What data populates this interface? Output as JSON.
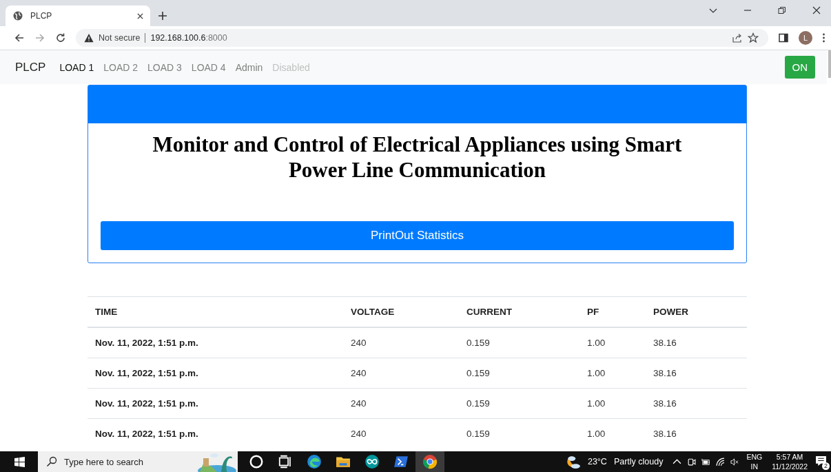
{
  "browser": {
    "tab_title": "PLCP",
    "security": "Not secure",
    "url_host": "192.168.100.6",
    "url_port": ":8000",
    "profile_initial": "L"
  },
  "navbar": {
    "brand": "PLCP",
    "items": [
      {
        "label": "LOAD 1",
        "selected": true,
        "disabled": false
      },
      {
        "label": "LOAD 2",
        "selected": false,
        "disabled": false
      },
      {
        "label": "LOAD 3",
        "selected": false,
        "disabled": false
      },
      {
        "label": "LOAD 4",
        "selected": false,
        "disabled": false
      },
      {
        "label": "Admin",
        "selected": false,
        "disabled": false
      },
      {
        "label": "Disabled",
        "selected": false,
        "disabled": true
      }
    ],
    "toggle": {
      "label": "ON",
      "on": true
    }
  },
  "card": {
    "title": "Monitor and Control of Electrical Appliances using Smart Power Line Communication",
    "button": "PrintOut Statistics"
  },
  "table": {
    "columns": [
      "TIME",
      "VOLTAGE",
      "CURRENT",
      "PF",
      "POWER"
    ],
    "rows": [
      [
        "Nov. 11, 2022, 1:51 p.m.",
        "240",
        "0.159",
        "1.00",
        "38.16"
      ],
      [
        "Nov. 11, 2022, 1:51 p.m.",
        "240",
        "0.159",
        "1.00",
        "38.16"
      ],
      [
        "Nov. 11, 2022, 1:51 p.m.",
        "240",
        "0.159",
        "1.00",
        "38.16"
      ],
      [
        "Nov. 11, 2022, 1:51 p.m.",
        "240",
        "0.159",
        "1.00",
        "38.16"
      ]
    ]
  },
  "taskbar": {
    "search_placeholder": "Type here to search",
    "temperature": "23°C",
    "weather": "Partly cloudy",
    "language": "ENG",
    "region": "IN",
    "time": "5:57 AM",
    "date": "11/12/2022",
    "notifications": "2"
  }
}
